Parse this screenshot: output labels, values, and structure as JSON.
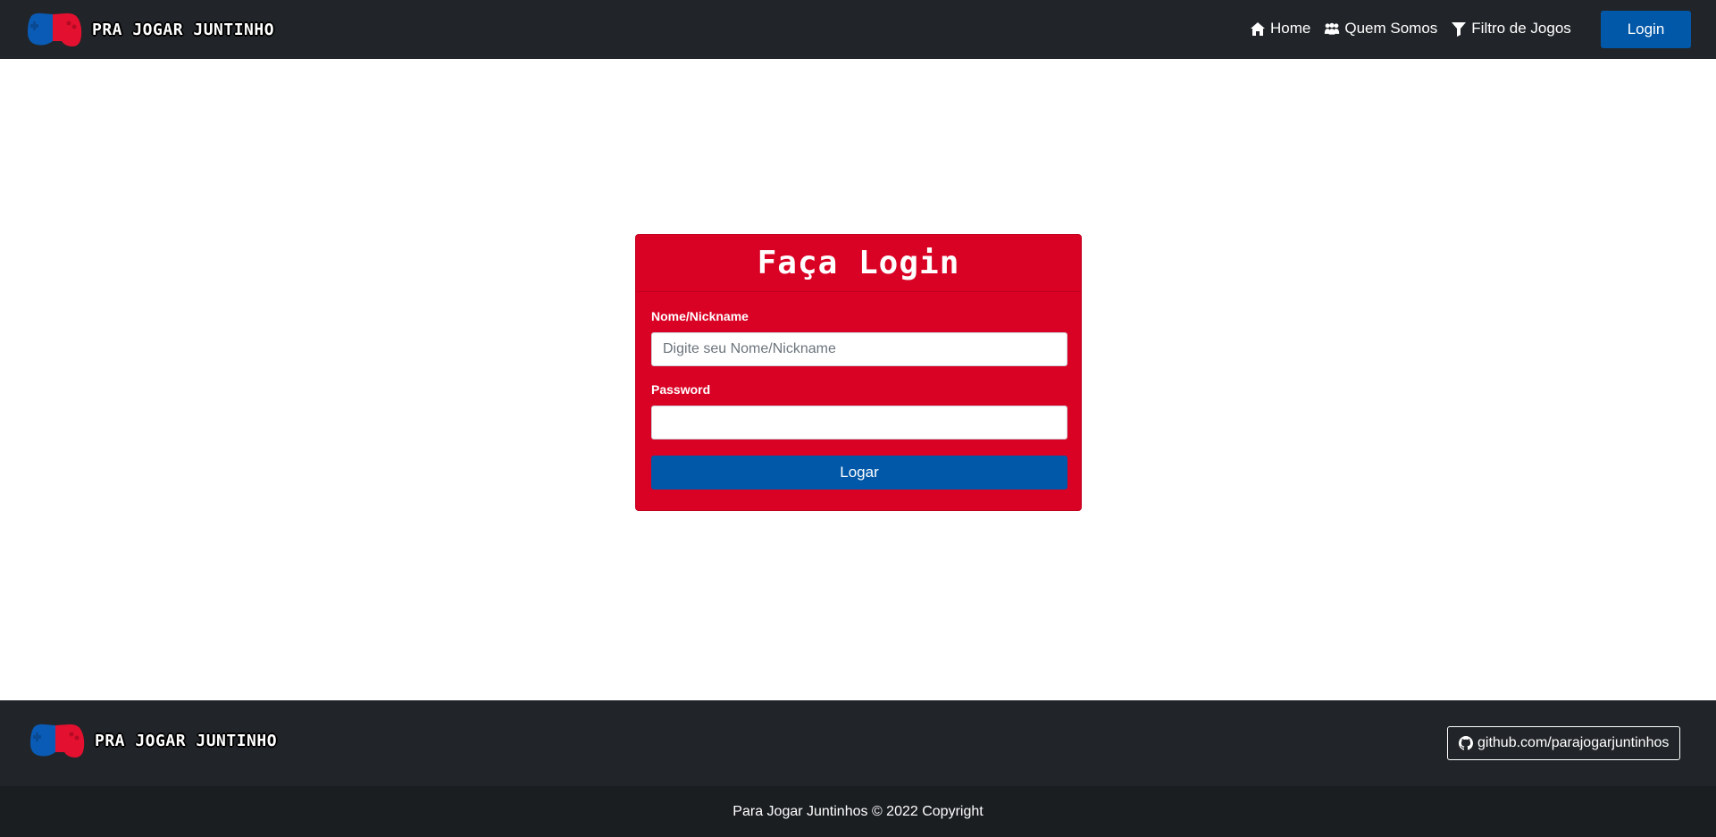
{
  "brand": {
    "name": "PRA JOGAR JUNTINHO",
    "logo_icon": "gamepad-logo"
  },
  "nav": {
    "items": [
      {
        "label": "Home",
        "icon": "home-icon"
      },
      {
        "label": "Quem Somos",
        "icon": "users-icon"
      },
      {
        "label": "Filtro de Jogos",
        "icon": "filter-icon"
      }
    ],
    "login_label": "Login"
  },
  "login_form": {
    "title": "Faça Login",
    "username_label": "Nome/Nickname",
    "username_placeholder": "Digite seu Nome/Nickname",
    "username_value": "",
    "password_label": "Password",
    "password_value": "",
    "submit_label": "Logar"
  },
  "footer": {
    "brand_name": "PRA JOGAR JUNTINHO",
    "github_label": "github.com/parajogarjuntinhos",
    "copyright": "Para Jogar Juntinhos © 2022 Copyright"
  },
  "colors": {
    "navbar": "#212529",
    "card": "#d90124",
    "primary_button": "#0258a8",
    "footer_bottom": "#1b1e21"
  }
}
